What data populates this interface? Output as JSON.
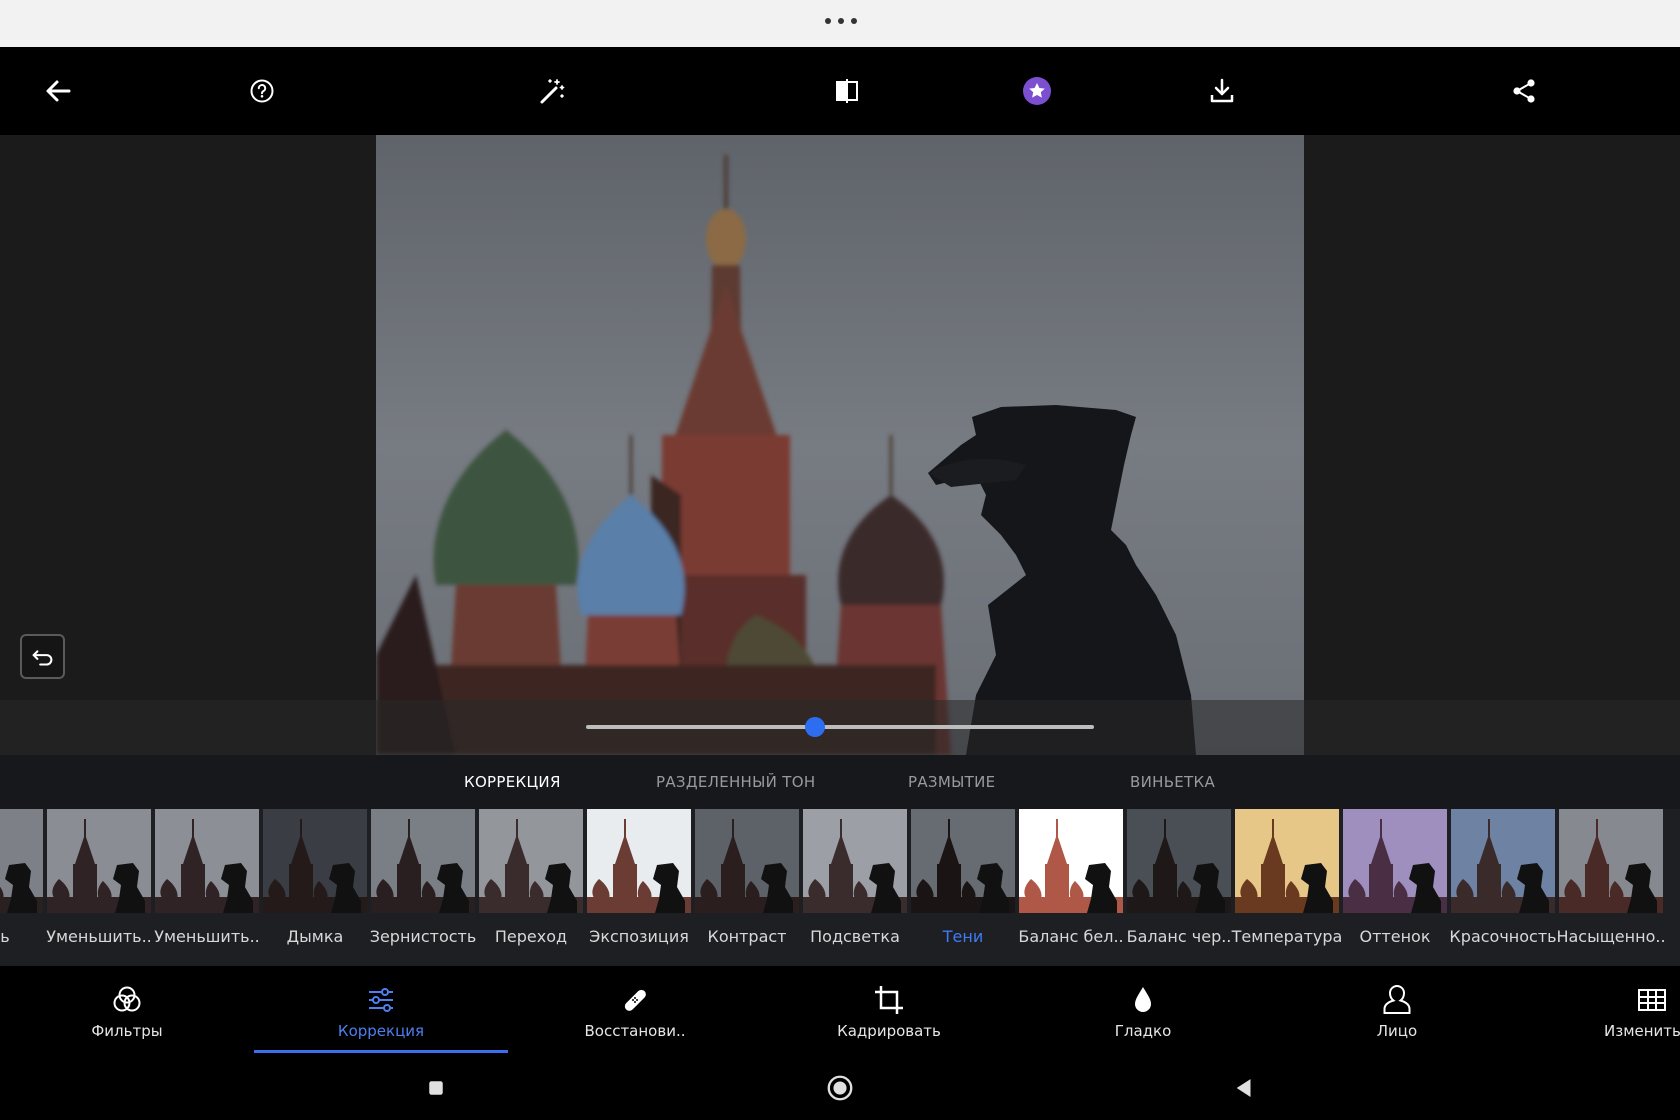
{
  "toolbar": {
    "back_icon": "arrow-left-icon",
    "help_icon": "help-circle-icon",
    "auto_fix_icon": "magic-wand-icon",
    "compare_icon": "before-after-icon",
    "premium_icon": "star-badge-icon",
    "download_icon": "download-icon",
    "share_icon": "share-icon",
    "accent_color": "#7b4fd0"
  },
  "editor": {
    "undo_icon": "undo-icon",
    "slider_value_fraction": 0.45,
    "accent_color": "#2d6df0"
  },
  "subtabs": [
    {
      "label": "КОРРЕКЦИЯ",
      "active": true
    },
    {
      "label": "РАЗДЕЛЕННЫЙ ТОН",
      "active": false
    },
    {
      "label": "РАЗМЫТИЕ",
      "active": false
    },
    {
      "label": "ВИНЬЕТКА",
      "active": false
    }
  ],
  "presets": [
    {
      "label": "ость",
      "active": false
    },
    {
      "label": "Уменьшить..",
      "active": false
    },
    {
      "label": "Уменьшить..",
      "active": false
    },
    {
      "label": "Дымка",
      "active": false
    },
    {
      "label": "Зернистость",
      "active": false
    },
    {
      "label": "Переход",
      "active": false
    },
    {
      "label": "Экспозиция",
      "active": false
    },
    {
      "label": "Контраст",
      "active": false
    },
    {
      "label": "Подсветка",
      "active": false
    },
    {
      "label": "Тени",
      "active": true
    },
    {
      "label": "Баланс бел..",
      "active": false
    },
    {
      "label": "Баланс чер..",
      "active": false
    },
    {
      "label": "Температура",
      "active": false
    },
    {
      "label": "Оттенок",
      "active": false
    },
    {
      "label": "Красочность",
      "active": false
    },
    {
      "label": "Насыщенно..",
      "active": false
    }
  ],
  "bottom_nav": [
    {
      "label": "Фильтры",
      "icon": "filters-icon",
      "active": false
    },
    {
      "label": "Коррекция",
      "icon": "sliders-icon",
      "active": true
    },
    {
      "label": "Восстанови..",
      "icon": "bandage-icon",
      "active": false
    },
    {
      "label": "Кадрировать",
      "icon": "crop-icon",
      "active": false
    },
    {
      "label": "Гладко",
      "icon": "drop-icon",
      "active": false
    },
    {
      "label": "Лицо",
      "icon": "face-icon",
      "active": false
    },
    {
      "label": "Изменить",
      "icon": "grid-icon",
      "active": false
    }
  ],
  "system_nav": {
    "recents_icon": "square-icon",
    "home_icon": "circle-icon",
    "back_icon": "triangle-back-icon"
  }
}
